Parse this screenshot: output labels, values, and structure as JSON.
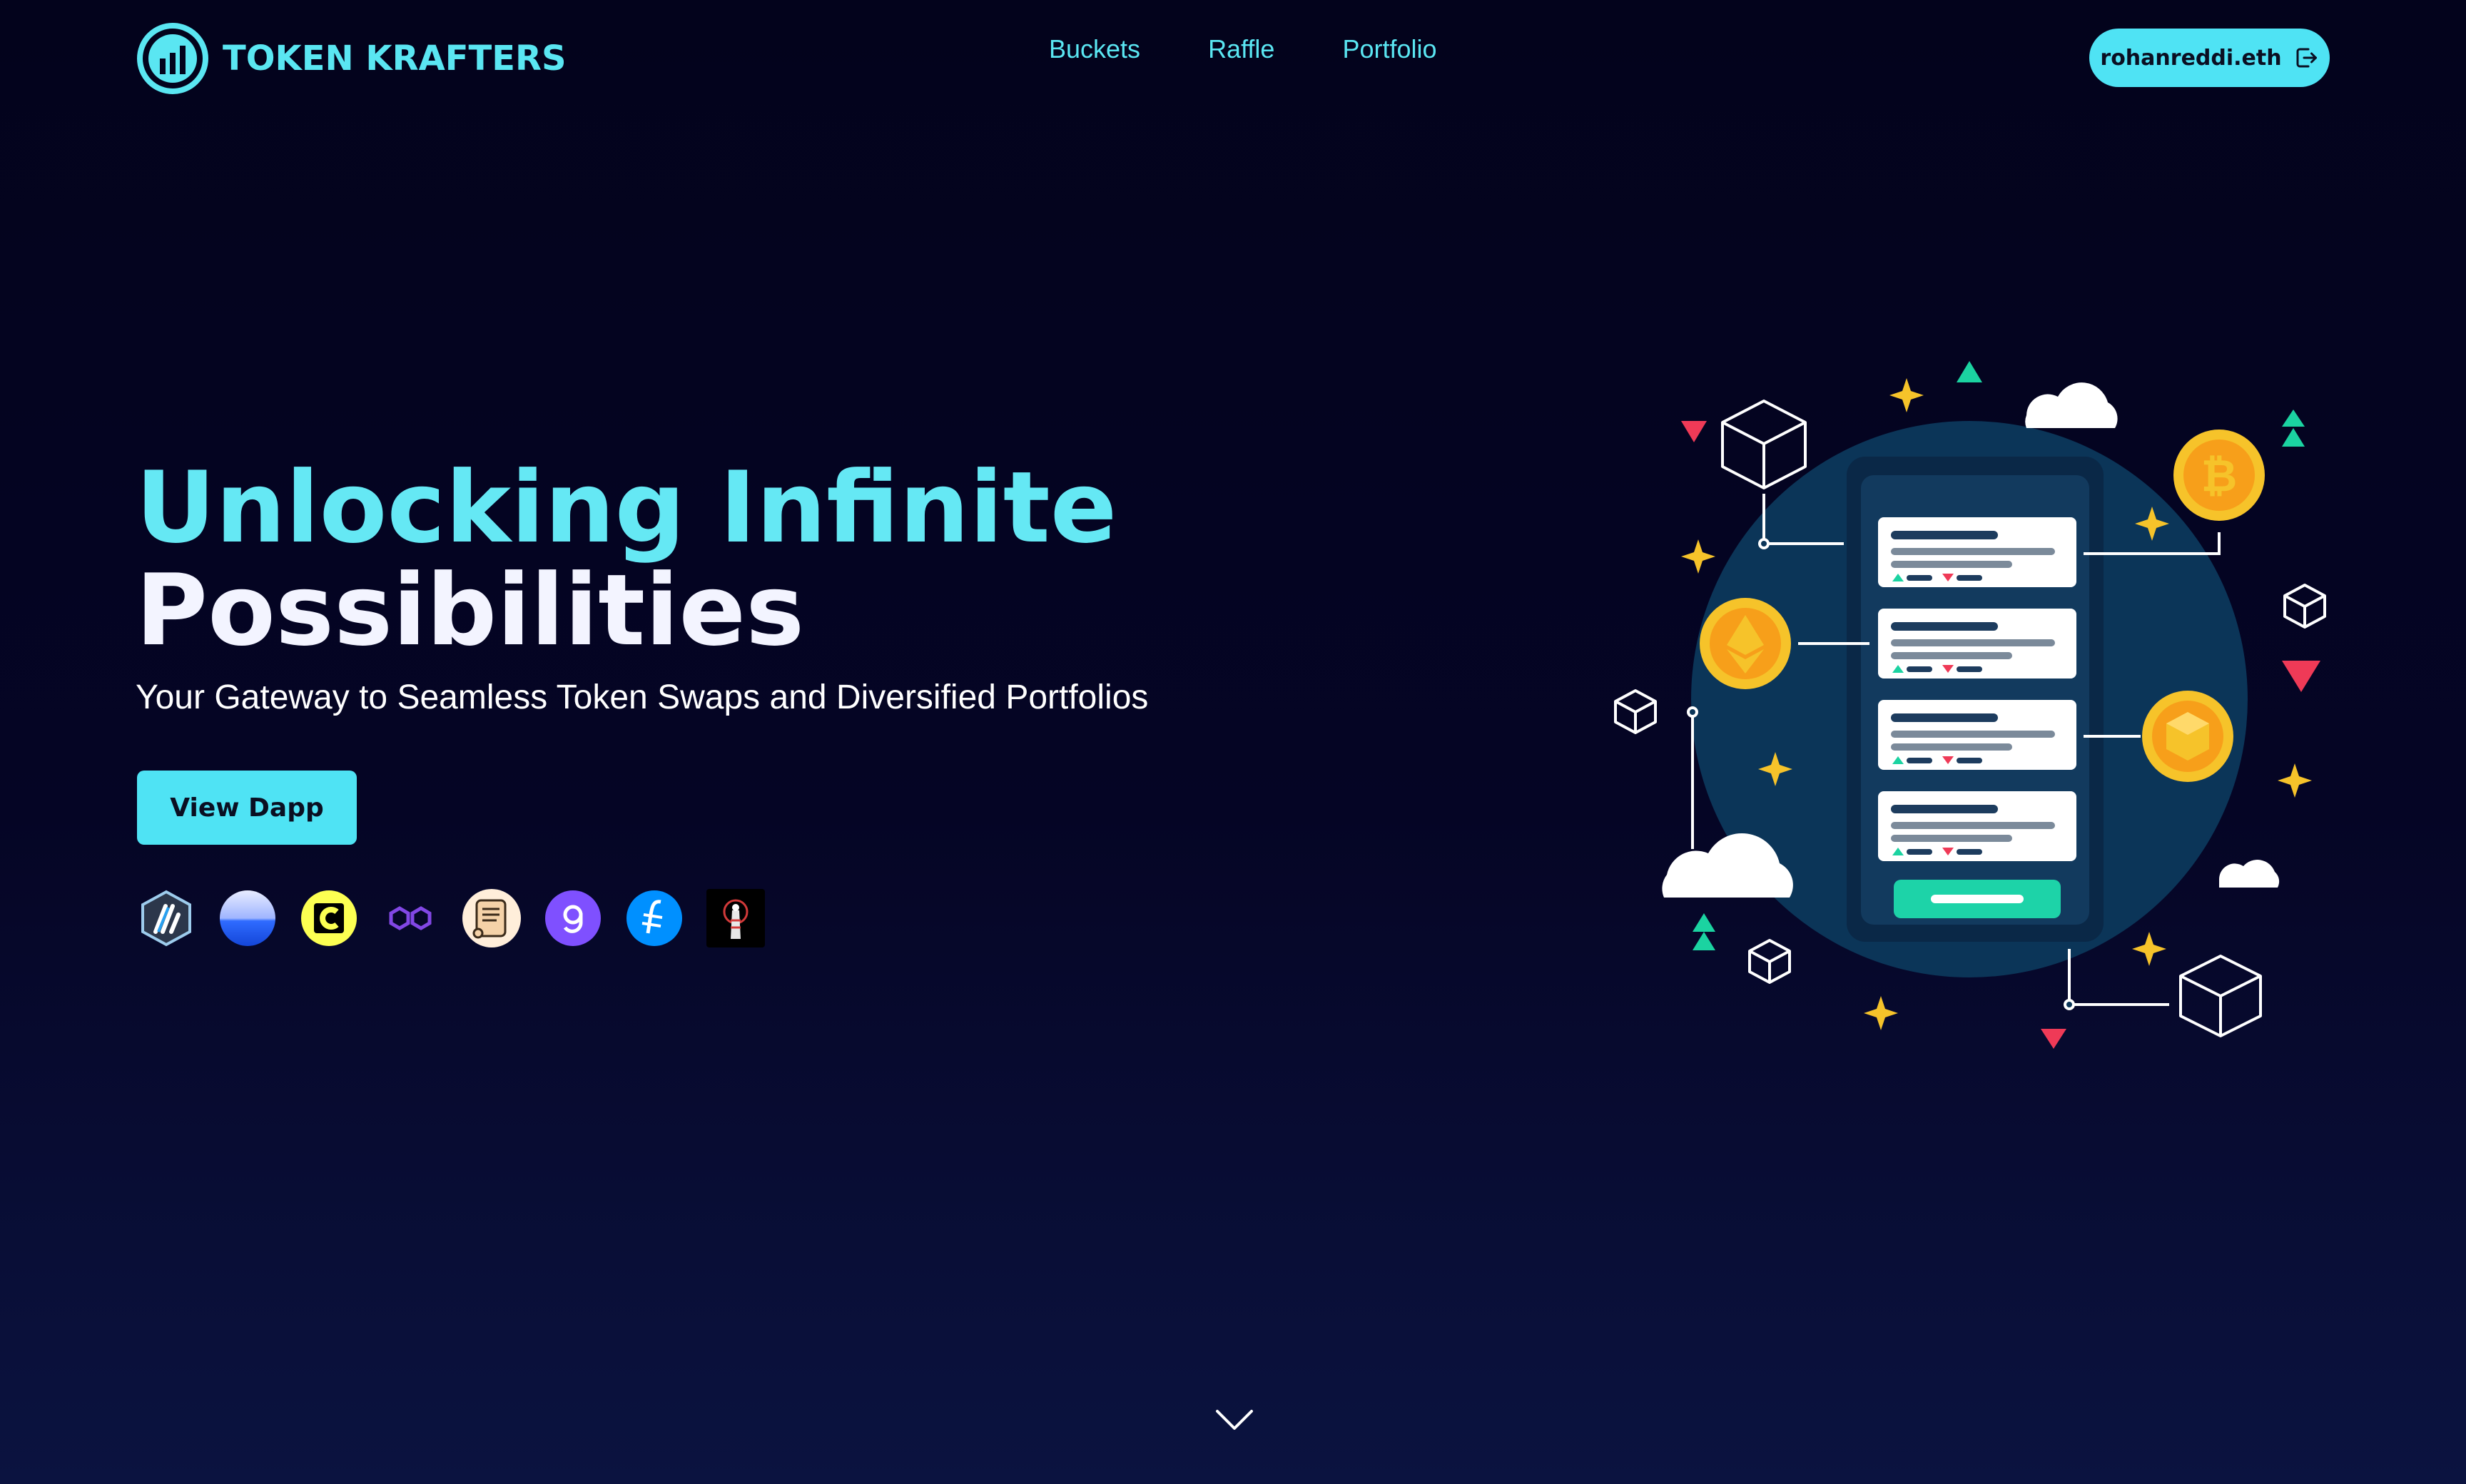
{
  "brand": {
    "name": "TOKEN KRAFTERS",
    "color": "#5ae6f2"
  },
  "nav": {
    "items": [
      {
        "label": "Buckets"
      },
      {
        "label": "Raffle"
      },
      {
        "label": "Portfolio"
      }
    ]
  },
  "wallet": {
    "address": "rohanreddi.eth",
    "icon": "logout-icon"
  },
  "hero": {
    "title_line1": "Unlocking Infinite",
    "title_line2": "Possibilities",
    "subtitle": "Your Gateway to Seamless Token Swaps and Diversified Portfolios",
    "cta_label": "View Dapp"
  },
  "chains": [
    {
      "icon": "arbitrum-icon"
    },
    {
      "icon": "optimism-icon"
    },
    {
      "icon": "celo-icon"
    },
    {
      "icon": "polygon-icon"
    },
    {
      "icon": "scroll-icon"
    },
    {
      "icon": "gnosis-icon"
    },
    {
      "icon": "filecoin-icon"
    },
    {
      "icon": "mantle-icon"
    }
  ],
  "colors": {
    "accent": "#4fe3f4",
    "background": "#03031c",
    "title_accent": "#65e8f4"
  }
}
